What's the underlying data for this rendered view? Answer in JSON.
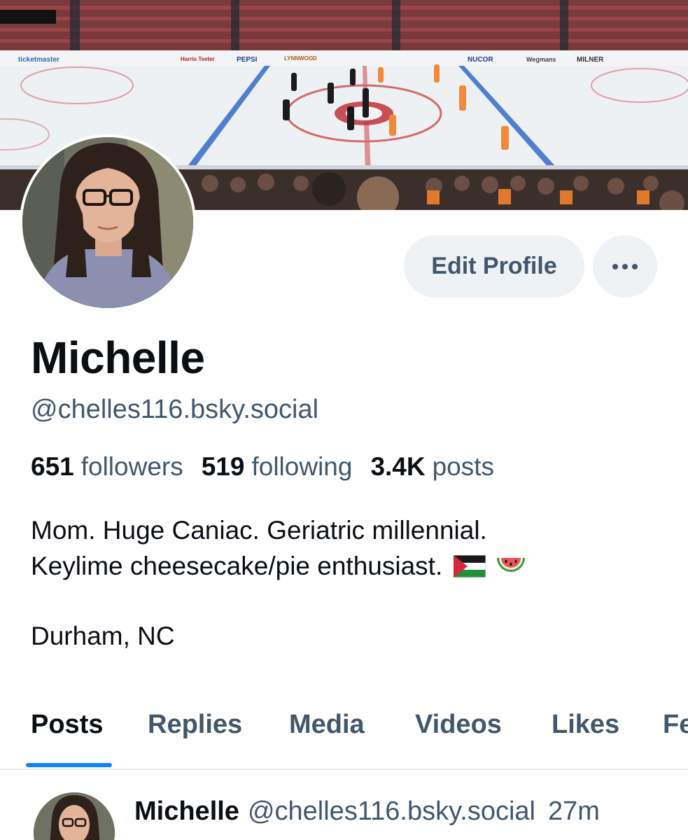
{
  "profile": {
    "display_name": "Michelle",
    "handle": "@chelles116.bsky.social",
    "bio_line1": "Mom. Huge Caniac. Geriatric millennial.",
    "bio_line2": "Keylime cheesecake/pie enthusiast.",
    "bio_emojis": [
      "palestine-flag-icon",
      "watermelon-icon"
    ],
    "location": "Durham, NC"
  },
  "actions": {
    "edit_profile_label": "Edit Profile",
    "more_icon": "more-horizontal-icon"
  },
  "stats": {
    "followers_count": "651",
    "followers_label": "followers",
    "following_count": "519",
    "following_label": "following",
    "posts_count": "3.4K",
    "posts_label": "posts"
  },
  "tabs": [
    {
      "label": "Posts",
      "active": true
    },
    {
      "label": "Replies",
      "active": false
    },
    {
      "label": "Media",
      "active": false
    },
    {
      "label": "Videos",
      "active": false
    },
    {
      "label": "Likes",
      "active": false
    },
    {
      "label": "Fe",
      "active": false
    }
  ],
  "post_preview": {
    "author_name": "Michelle",
    "author_handle": "@chelles116.bsky.social",
    "time": "27m"
  },
  "banner": {
    "arena_board_ads": [
      "ticketmaster",
      "PEPSI",
      "LYNNWOOD",
      "NUCOR",
      "Wegmans",
      "MILNER",
      "Harris Teeter"
    ]
  },
  "colors": {
    "accent": "#1083fe",
    "primary_text": "#0b0f14",
    "secondary_text": "#42576c",
    "button_bg": "#eff2f5"
  }
}
